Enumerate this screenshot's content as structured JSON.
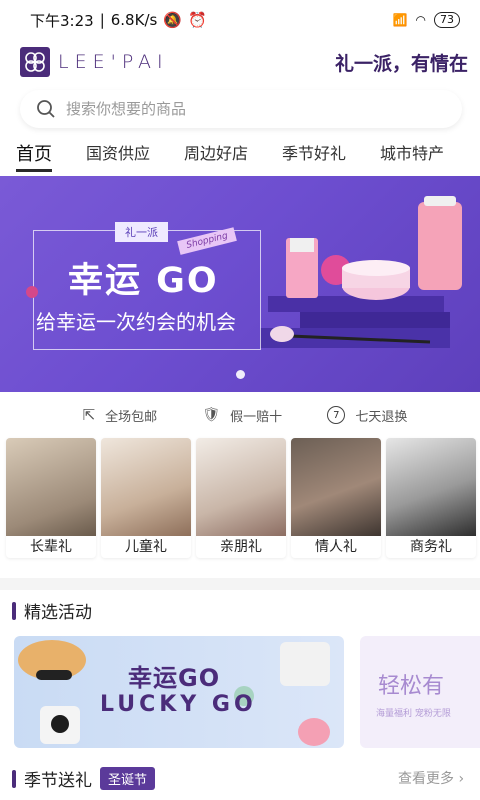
{
  "status_bar": {
    "time": "下午3:23",
    "speed": "6.8K/s",
    "battery": "73"
  },
  "header": {
    "logo_text": "LEE'PAI",
    "slogan": "礼一派，有情在"
  },
  "search": {
    "placeholder": "搜索你想要的商品"
  },
  "tabs": [
    "首页",
    "国资供应",
    "周边好店",
    "季节好礼",
    "城市特产"
  ],
  "banner": {
    "tag": "礼一派",
    "shopping_tag": "Shopping",
    "title": "幸运 GO",
    "subtitle": "给幸运一次约会的机会"
  },
  "services": [
    "全场包邮",
    "假一赔十",
    "七天退换"
  ],
  "categories": [
    "长辈礼",
    "儿童礼",
    "亲朋礼",
    "情人礼",
    "商务礼"
  ],
  "featured": {
    "title": "精选活动",
    "main_title": "幸运GO",
    "main_sub": "LUCKY GO",
    "side_title": "轻松有",
    "side_sub": "海量福利 宠粉无限"
  },
  "seasonal": {
    "title": "季节送礼",
    "badge": "圣诞节",
    "more": "查看更多"
  },
  "colors": {
    "brand": "#4b2c7a",
    "banner": "#6d4ed0"
  }
}
